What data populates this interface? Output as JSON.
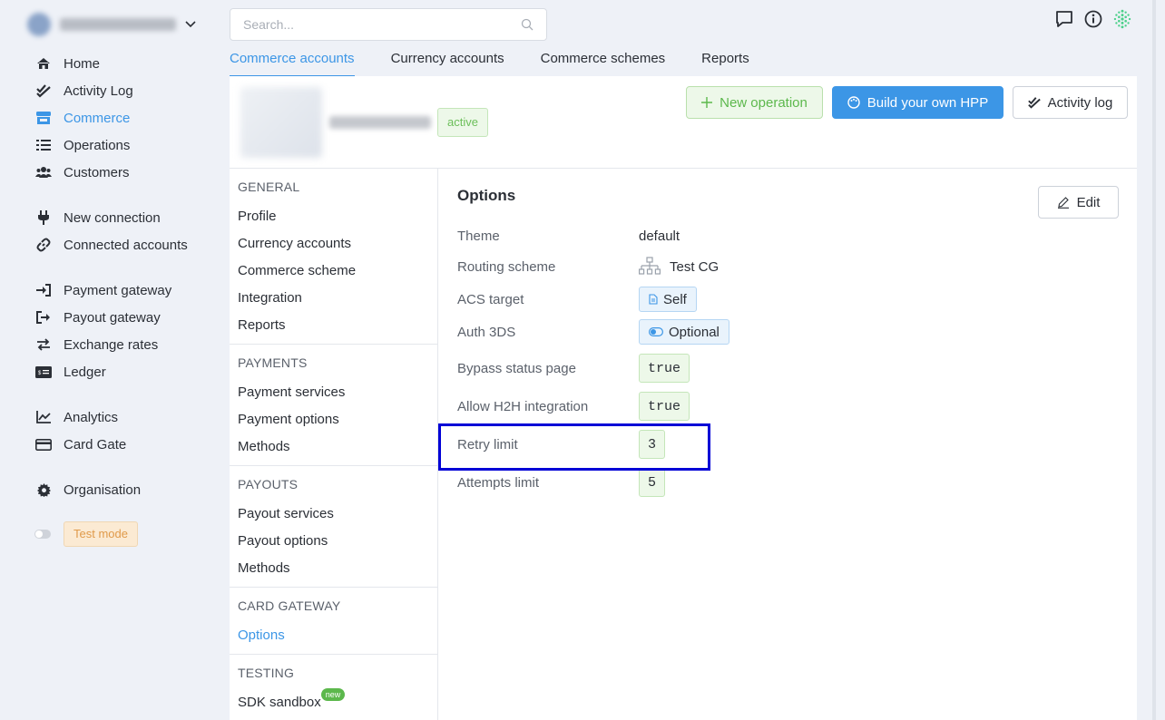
{
  "account": {
    "name": "DEMO ACCOUNT"
  },
  "nav": {
    "items": [
      {
        "label": "Home",
        "icon": "home-icon"
      },
      {
        "label": "Activity Log",
        "icon": "double-check-icon"
      },
      {
        "label": "Commerce",
        "icon": "store-icon",
        "active": true
      },
      {
        "label": "Operations",
        "icon": "list-icon"
      },
      {
        "label": "Customers",
        "icon": "users-icon"
      },
      {
        "label": "New connection",
        "icon": "plug-icon"
      },
      {
        "label": "Connected accounts",
        "icon": "link-icon"
      },
      {
        "label": "Payment gateway",
        "icon": "sign-in-icon"
      },
      {
        "label": "Payout gateway",
        "icon": "sign-out-icon"
      },
      {
        "label": "Exchange rates",
        "icon": "exchange-icon"
      },
      {
        "label": "Ledger",
        "icon": "ledger-icon"
      },
      {
        "label": "Analytics",
        "icon": "chart-line-icon"
      },
      {
        "label": "Card Gate",
        "icon": "credit-card-icon"
      },
      {
        "label": "Organisation",
        "icon": "gear-icon"
      }
    ],
    "test_mode_label": "Test mode"
  },
  "search": {
    "placeholder": "Search..."
  },
  "tabs": [
    {
      "label": "Commerce accounts",
      "active": true
    },
    {
      "label": "Currency accounts"
    },
    {
      "label": "Commerce schemes"
    },
    {
      "label": "Reports"
    }
  ],
  "header": {
    "status": "active",
    "new_operation_label": "New operation",
    "build_hpp_label": "Build your own HPP",
    "activity_log_label": "Activity log"
  },
  "submenu": {
    "general": {
      "title": "GENERAL",
      "items": [
        "Profile",
        "Currency accounts",
        "Commerce scheme",
        "Integration",
        "Reports"
      ]
    },
    "payments": {
      "title": "PAYMENTS",
      "items": [
        "Payment services",
        "Payment options",
        "Methods"
      ]
    },
    "payouts": {
      "title": "PAYOUTS",
      "items": [
        "Payout services",
        "Payout options",
        "Methods"
      ]
    },
    "card_gateway": {
      "title": "CARD GATEWAY",
      "items": [
        "Options"
      ]
    },
    "testing": {
      "title": "TESTING",
      "items": [
        "SDK sandbox"
      ],
      "new_badge": "new"
    }
  },
  "options": {
    "title": "Options",
    "edit_label": "Edit",
    "rows": [
      {
        "label": "Theme",
        "value": "default"
      },
      {
        "label": "Routing scheme",
        "value": "Test CG"
      },
      {
        "label": "ACS target",
        "value": "Self"
      },
      {
        "label": "Auth 3DS",
        "value": "Optional"
      },
      {
        "label": "Bypass status page",
        "value": "true"
      },
      {
        "label": "Allow H2H integration",
        "value": "true"
      },
      {
        "label": "Retry limit",
        "value": "3"
      },
      {
        "label": "Attempts limit",
        "value": "5"
      }
    ]
  },
  "colors": {
    "accent": "#3c96e6",
    "success": "#5cb84c",
    "highlight_box": "#0000d6"
  }
}
